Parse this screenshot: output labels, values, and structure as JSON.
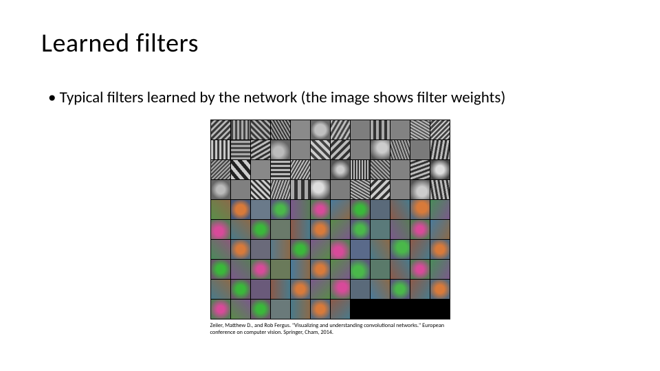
{
  "slide": {
    "title": "Learned filters",
    "bullet": "Typical filters learned by the network (the image shows filter weights)",
    "caption": "Zeiler, Matthew D., and Rob Fergus. \"Visualizing and understanding convolutional networks.\" European conference on computer vision. Springer, Cham, 2014."
  },
  "grid": {
    "cols": 12,
    "rows": 10,
    "cells": [
      {
        "bg": "repeating-linear-gradient(135deg,#3a3a3a 0 3px,#b8b8b8 3px 6px)"
      },
      {
        "bg": "repeating-linear-gradient(90deg,#444 0 3px,#aaa 3px 6px)"
      },
      {
        "bg": "repeating-linear-gradient(45deg,#3a3a3a 0 3px,#b0b0b0 3px 6px)"
      },
      {
        "bg": "repeating-linear-gradient(60deg,#333 0 2px,#a2a2a2 2px 4px)"
      },
      {
        "bg": "#8a8a8a"
      },
      {
        "bg": "radial-gradient(circle at 50% 50%,#c0c0c0 0 40%,#6a6a6a 70%)"
      },
      {
        "bg": "repeating-linear-gradient(120deg,#bbb 0 3px,#444 3px 6px)"
      },
      {
        "bg": "#7e7e7e"
      },
      {
        "bg": "repeating-linear-gradient(90deg,#aaa 0 4px,#333 4px 8px)"
      },
      {
        "bg": "#828282"
      },
      {
        "bg": "repeating-linear-gradient(30deg,#bbb 0 2px,#555 2px 4px)"
      },
      {
        "bg": "repeating-linear-gradient(135deg,#ccc 0 2px,#444 2px 5px)"
      },
      {
        "bg": "repeating-linear-gradient(90deg,#c8c8c8 0 3px,#3a3a3a 3px 6px)"
      },
      {
        "bg": "repeating-linear-gradient(0deg,#aaa 0 3px,#444 3px 6px)"
      },
      {
        "bg": "repeating-linear-gradient(150deg,#bbb 0 3px,#333 3px 6px)"
      },
      {
        "bg": "radial-gradient(circle at 40% 60%,#bbb 0 30%,#666 70%)"
      },
      {
        "bg": "#858585"
      },
      {
        "bg": "repeating-linear-gradient(45deg,#ccc 0 4px,#444 4px 8px)"
      },
      {
        "bg": "repeating-linear-gradient(135deg,#bbb 0 4px,#333 4px 8px)"
      },
      {
        "bg": "#808080"
      },
      {
        "bg": "radial-gradient(circle at 60% 40%,#ccc 0 30%,#555 80%)"
      },
      {
        "bg": "repeating-linear-gradient(70deg,#aaa 0 2px,#444 2px 4px)"
      },
      {
        "bg": "#7a7a7a"
      },
      {
        "bg": "repeating-linear-gradient(100deg,#bbb 0 3px,#333 3px 6px)"
      },
      {
        "bg": "repeating-linear-gradient(135deg,#aaa 0 2px,#444 2px 4px)"
      },
      {
        "bg": "repeating-linear-gradient(50deg,#ccc 0 5px,#222 5px 10px)"
      },
      {
        "bg": "#888"
      },
      {
        "bg": "repeating-linear-gradient(0deg,#bbb 0 3px,#333 3px 6px)"
      },
      {
        "bg": "repeating-linear-gradient(120deg,#c0c0c0 0 2px,#444 2px 4px)"
      },
      {
        "bg": "#7f7f7f"
      },
      {
        "bg": "radial-gradient(circle at 50% 50%,#ccc 0 25%,#555 70%)"
      },
      {
        "bg": "repeating-linear-gradient(90deg,#bbb 0 2px,#333 2px 4px)"
      },
      {
        "bg": "repeating-linear-gradient(45deg,#aaa 0 2px,#444 2px 4px)"
      },
      {
        "bg": "#828282"
      },
      {
        "bg": "repeating-linear-gradient(160deg,#bbb 0 3px,#333 3px 6px)"
      },
      {
        "bg": "radial-gradient(circle at 50% 50%,#ddd 0 30%,#444 80%)"
      },
      {
        "bg": "radial-gradient(circle at 50% 50%,#bbb 0 30%,#666 70%)"
      },
      {
        "bg": "#808080"
      },
      {
        "bg": "repeating-linear-gradient(45deg,#ccc 0 3px,#333 3px 6px)"
      },
      {
        "bg": "repeating-linear-gradient(110deg,#bbb 0 2px,#444 2px 4px)"
      },
      {
        "bg": "repeating-linear-gradient(90deg,#aaa 0 5px,#333 5px 10px)"
      },
      {
        "bg": "radial-gradient(circle at 40% 40%,#ddd 0 30%,#555 80%)"
      },
      {
        "bg": "#7d7d7d"
      },
      {
        "bg": "repeating-linear-gradient(30deg,#bbb 0 2px,#444 2px 4px)"
      },
      {
        "bg": "repeating-linear-gradient(135deg,#ccc 0 4px,#333 4px 8px)"
      },
      {
        "bg": "#838383"
      },
      {
        "bg": "radial-gradient(circle at 60% 60%,#ccc 0 30%,#555 80%)"
      },
      {
        "bg": "repeating-linear-gradient(80deg,#bbb 0 3px,#333 3px 6px)"
      },
      {
        "bg": "linear-gradient(45deg,#5a8f4a,#8a6a4a)"
      },
      {
        "bg": "radial-gradient(circle at 50% 50%,#d87a3a 0 35%,#4a5a7a 80%)"
      },
      {
        "bg": "#6a7a8a"
      },
      {
        "bg": "radial-gradient(circle at 50% 50%,#4ab84a 0 30%,#5a5a7a 80%)"
      },
      {
        "bg": "linear-gradient(90deg,#7a5a8a,#5a7a5a)"
      },
      {
        "bg": "radial-gradient(circle at 50% 50%,#d84a9a 0 25%,#5a7a5a 80%)"
      },
      {
        "bg": "linear-gradient(135deg,#4a7a9a,#8a6a4a)"
      },
      {
        "bg": "radial-gradient(circle at 50% 50%,#3ab83a 0 30%,#6a5a6a 80%)"
      },
      {
        "bg": "#5a6a7a"
      },
      {
        "bg": "linear-gradient(60deg,#8a5a4a,#4a7a8a)"
      },
      {
        "bg": "radial-gradient(circle at 60% 40%,#d87a3a 0 30%,#5a6a7a 80%)"
      },
      {
        "bg": "linear-gradient(120deg,#4a8a5a,#7a5a8a)"
      },
      {
        "bg": "radial-gradient(circle at 40% 60%,#d84a9a 0 25%,#5a7a5a 80%)"
      },
      {
        "bg": "linear-gradient(45deg,#4a7a8a,#8a6a4a)"
      },
      {
        "bg": "radial-gradient(circle at 50% 50%,#3ab83a 0 30%,#6a5a6a 80%)"
      },
      {
        "bg": "#6a7a6a"
      },
      {
        "bg": "linear-gradient(90deg,#8a5a4a,#4a7a8a)"
      },
      {
        "bg": "radial-gradient(circle at 50% 50%,#d87a3a 0 30%,#5a6a7a 80%)"
      },
      {
        "bg": "linear-gradient(135deg,#5a8a4a,#7a5a8a)"
      },
      {
        "bg": "radial-gradient(circle at 50% 50%,#4ab84a 0 30%,#5a5a7a 80%)"
      },
      {
        "bg": "#5a7a7a"
      },
      {
        "bg": "linear-gradient(60deg,#7a5a8a,#5a7a5a)"
      },
      {
        "bg": "radial-gradient(circle at 50% 50%,#d84a9a 0 25%,#5a7a5a 80%)"
      },
      {
        "bg": "linear-gradient(120deg,#4a7a9a,#8a6a4a)"
      },
      {
        "bg": "linear-gradient(45deg,#4a8a5a,#8a5a7a)"
      },
      {
        "bg": "radial-gradient(circle at 50% 50%,#d87a3a 0 30%,#5a6a7a 80%)"
      },
      {
        "bg": "#6a6a7a"
      },
      {
        "bg": "linear-gradient(90deg,#5a7a8a,#8a6a4a)"
      },
      {
        "bg": "radial-gradient(circle at 50% 50%,#3ab83a 0 30%,#6a5a6a 80%)"
      },
      {
        "bg": "linear-gradient(135deg,#7a5a8a,#5a8a4a)"
      },
      {
        "bg": "radial-gradient(circle at 40% 60%,#d84a9a 0 25%,#5a7a5a 80%)"
      },
      {
        "bg": "#5a6a8a"
      },
      {
        "bg": "linear-gradient(60deg,#4a7a8a,#8a6a4a)"
      },
      {
        "bg": "radial-gradient(circle at 60% 40%,#4ab84a 0 30%,#5a5a7a 80%)"
      },
      {
        "bg": "linear-gradient(120deg,#8a5a4a,#4a7a8a)"
      },
      {
        "bg": "radial-gradient(circle at 50% 50%,#d87a3a 0 30%,#5a6a7a 80%)"
      },
      {
        "bg": "radial-gradient(circle at 50% 50%,#3ab83a 0 30%,#6a5a6a 80%)"
      },
      {
        "bg": "linear-gradient(45deg,#7a5a8a,#5a7a5a)"
      },
      {
        "bg": "radial-gradient(circle at 50% 50%,#d84a9a 0 25%,#5a7a5a 80%)"
      },
      {
        "bg": "#6a7a5a"
      },
      {
        "bg": "linear-gradient(90deg,#4a7a9a,#8a6a4a)"
      },
      {
        "bg": "radial-gradient(circle at 50% 50%,#d87a3a 0 30%,#5a6a7a 80%)"
      },
      {
        "bg": "linear-gradient(135deg,#5a8a4a,#7a5a8a)"
      },
      {
        "bg": "radial-gradient(circle at 40% 60%,#4ab84a 0 30%,#5a5a7a 80%)"
      },
      {
        "bg": "#5a7a6a"
      },
      {
        "bg": "linear-gradient(60deg,#8a5a4a,#4a7a8a)"
      },
      {
        "bg": "radial-gradient(circle at 50% 50%,#d84a9a 0 25%,#5a7a5a 80%)"
      },
      {
        "bg": "linear-gradient(120deg,#4a8a5a,#7a5a8a)"
      },
      {
        "bg": "linear-gradient(45deg,#4a7a8a,#8a6a4a)"
      },
      {
        "bg": "radial-gradient(circle at 50% 50%,#3ab83a 0 30%,#6a5a6a 80%)"
      },
      {
        "bg": "#6a5a7a"
      },
      {
        "bg": "linear-gradient(90deg,#8a5a4a,#4a7a8a)"
      },
      {
        "bg": "radial-gradient(circle at 50% 50%,#d87a3a 0 30%,#5a6a7a 80%)"
      },
      {
        "bg": "linear-gradient(135deg,#7a5a8a,#5a8a4a)"
      },
      {
        "bg": "radial-gradient(circle at 60% 40%,#d84a9a 0 25%,#5a7a5a 80%)"
      },
      {
        "bg": "#5a6a7a"
      },
      {
        "bg": "linear-gradient(60deg,#4a7a9a,#8a6a4a)"
      },
      {
        "bg": "radial-gradient(circle at 50% 50%,#4ab84a 0 30%,#5a5a7a 80%)"
      },
      {
        "bg": "linear-gradient(120deg,#8a5a4a,#4a7a8a)"
      },
      {
        "bg": "radial-gradient(circle at 50% 50%,#d87a3a 0 30%,#5a6a7a 80%)"
      },
      {
        "bg": "radial-gradient(circle at 50% 50%,#d84a9a 0 25%,#5a7a5a 80%)"
      },
      {
        "bg": "linear-gradient(45deg,#5a8a4a,#7a5a8a)"
      },
      {
        "bg": "radial-gradient(circle at 50% 50%,#3ab83a 0 30%,#6a5a6a 80%)"
      },
      {
        "bg": "#6a7a7a"
      },
      {
        "bg": "linear-gradient(90deg,#4a7a8a,#8a6a4a)"
      },
      {
        "bg": "radial-gradient(circle at 50% 50%,#d87a3a 0 30%,#5a6a7a 80%)"
      },
      {
        "bg": "linear-gradient(135deg,#8a5a4a,#4a7a8a)"
      },
      {
        "black": true
      },
      {
        "black": true
      },
      {
        "black": true
      },
      {
        "black": true
      },
      {
        "black": true
      }
    ]
  }
}
